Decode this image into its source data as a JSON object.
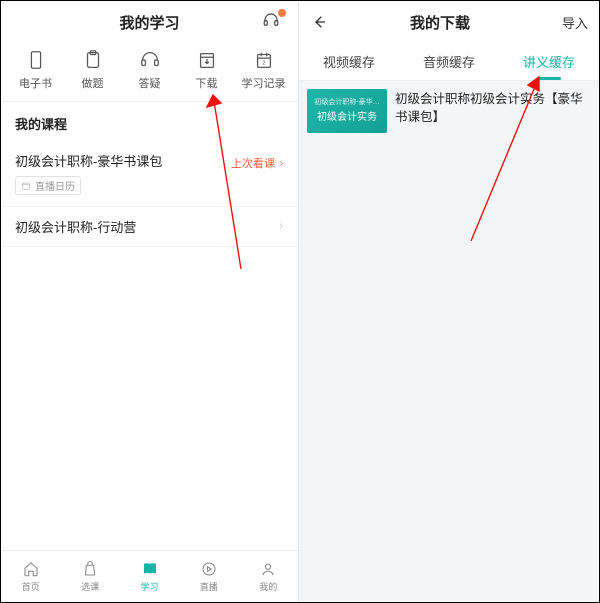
{
  "left": {
    "header": {
      "title": "我的学习"
    },
    "toolbar": [
      {
        "label": "电子书"
      },
      {
        "label": "做题"
      },
      {
        "label": "答疑"
      },
      {
        "label": "下载"
      },
      {
        "label": "学习记录"
      }
    ],
    "section_title": "我的课程",
    "courses": [
      {
        "name": "初级会计职称-豪华书课包",
        "sub": "直播日历",
        "last": "上次看课"
      },
      {
        "name": "初级会计职称-行动营"
      }
    ],
    "bottomnav": [
      {
        "label": "首页"
      },
      {
        "label": "选课"
      },
      {
        "label": "学习"
      },
      {
        "label": "直播"
      },
      {
        "label": "我的"
      }
    ],
    "bottom_active_index": 2
  },
  "right": {
    "header": {
      "title": "我的下载",
      "action": "导入"
    },
    "tabs": [
      {
        "label": "视频缓存"
      },
      {
        "label": "音频缓存"
      },
      {
        "label": "讲义缓存"
      }
    ],
    "active_tab_index": 2,
    "download": {
      "thumb_line1": "初级会计职称-豪华…",
      "thumb_line2": "初级会计实务",
      "title": "初级会计职称初级会计实务【豪华书课包】"
    }
  },
  "colors": {
    "accent": "#16b5a8",
    "warn": "#ff5a3c"
  }
}
